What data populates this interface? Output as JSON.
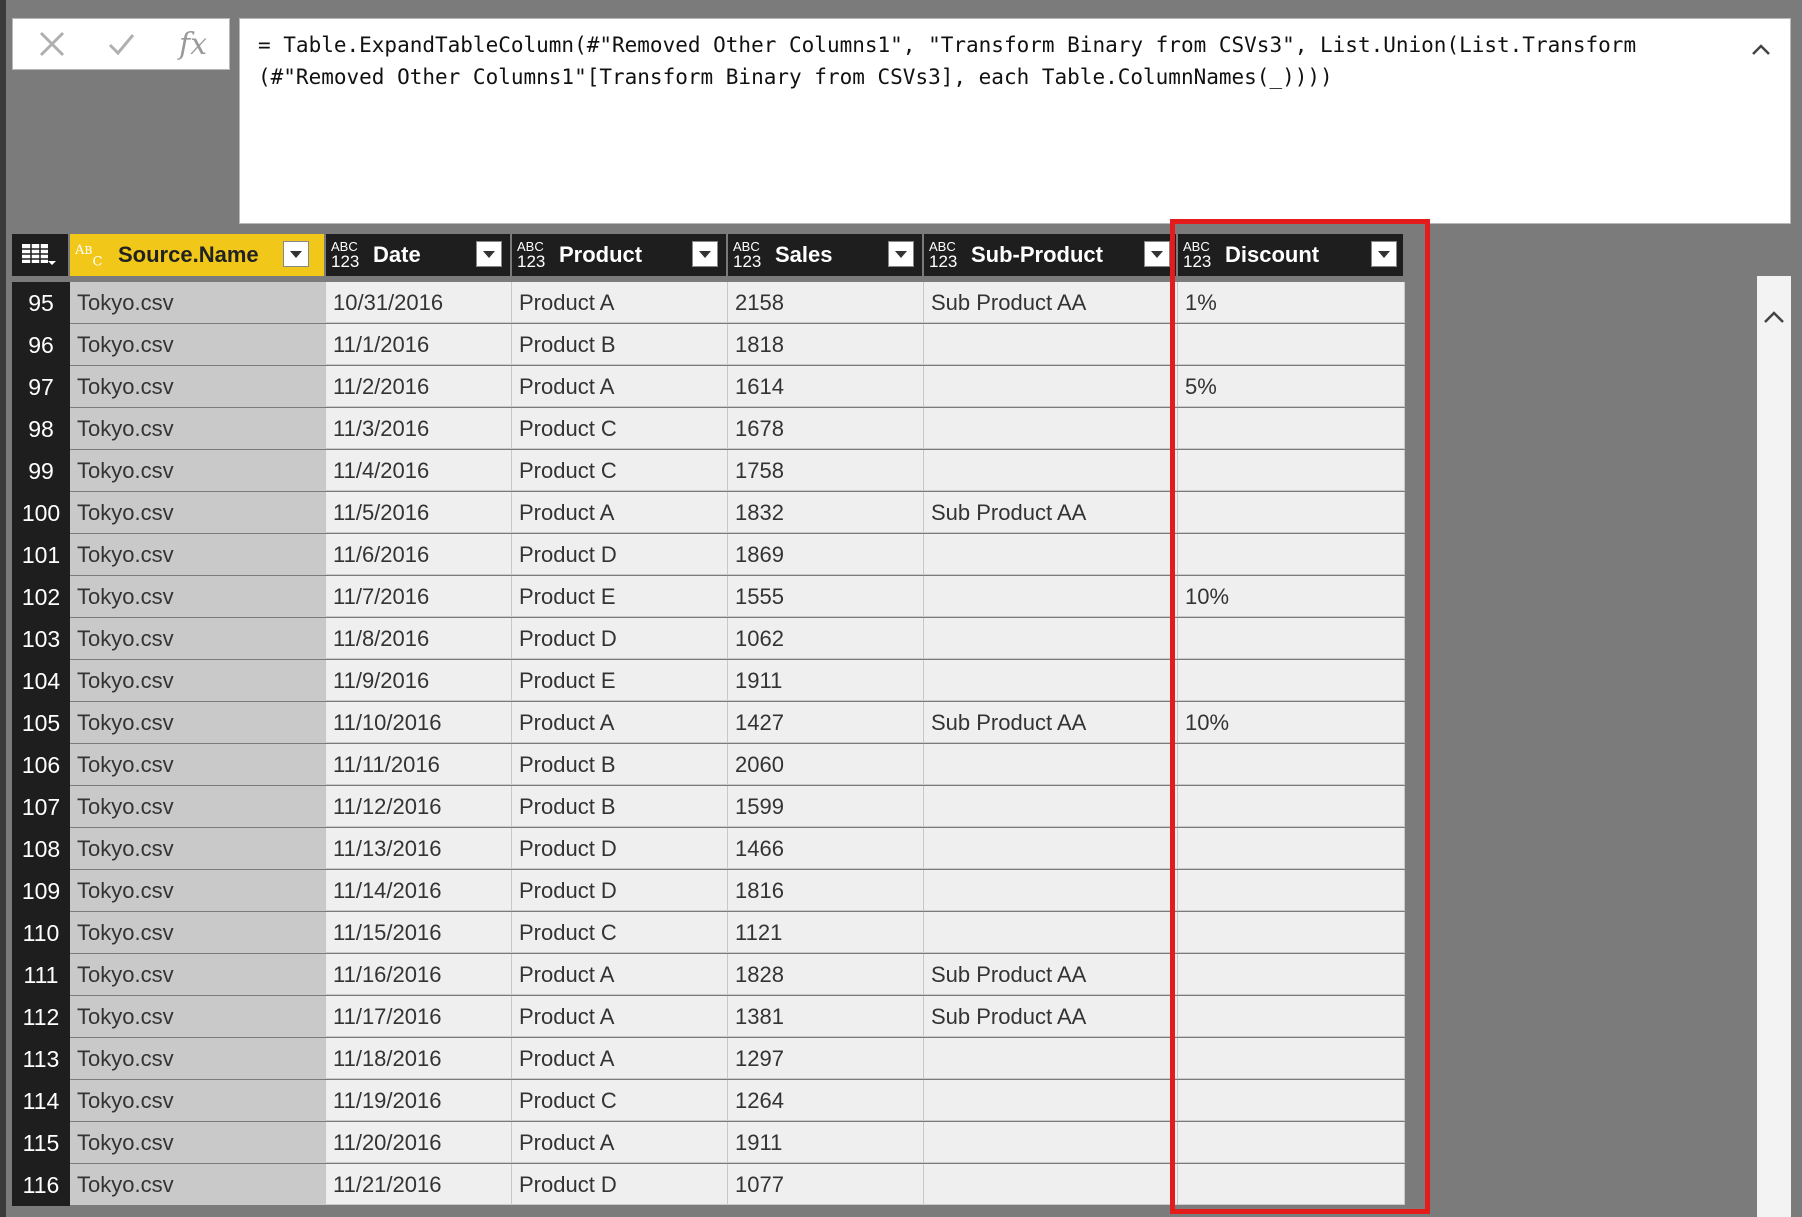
{
  "formula_bar": {
    "cancel_icon": "close-icon",
    "commit_icon": "check-icon",
    "fx_label": "fx",
    "formula": "= Table.ExpandTableColumn(#\"Removed Other Columns1\", \"Transform Binary from CSVs3\", List.Union(List.Transform\n(#\"Removed Other Columns1\"[Transform Binary from CSVs3], each Table.ColumnNames(_))))"
  },
  "columns": [
    {
      "label": "Source.Name",
      "type": "text",
      "type_abc": "ABC",
      "type_num": ""
    },
    {
      "label": "Date",
      "type": "any",
      "type_abc": "ABC",
      "type_num": "123"
    },
    {
      "label": "Product",
      "type": "any",
      "type_abc": "ABC",
      "type_num": "123"
    },
    {
      "label": "Sales",
      "type": "any",
      "type_abc": "ABC",
      "type_num": "123"
    },
    {
      "label": "Sub-Product",
      "type": "any",
      "type_abc": "ABC",
      "type_num": "123"
    },
    {
      "label": "Discount",
      "type": "any",
      "type_abc": "ABC",
      "type_num": "123"
    }
  ],
  "rows": [
    {
      "n": "95",
      "cells": [
        "Tokyo.csv",
        "10/31/2016",
        "Product A",
        "2158",
        "Sub Product AA",
        "1%"
      ]
    },
    {
      "n": "96",
      "cells": [
        "Tokyo.csv",
        "11/1/2016",
        "Product B",
        "1818",
        "",
        ""
      ]
    },
    {
      "n": "97",
      "cells": [
        "Tokyo.csv",
        "11/2/2016",
        "Product A",
        "1614",
        "",
        "5%"
      ]
    },
    {
      "n": "98",
      "cells": [
        "Tokyo.csv",
        "11/3/2016",
        "Product C",
        "1678",
        "",
        ""
      ]
    },
    {
      "n": "99",
      "cells": [
        "Tokyo.csv",
        "11/4/2016",
        "Product C",
        "1758",
        "",
        ""
      ]
    },
    {
      "n": "100",
      "cells": [
        "Tokyo.csv",
        "11/5/2016",
        "Product A",
        "1832",
        "Sub Product AA",
        ""
      ]
    },
    {
      "n": "101",
      "cells": [
        "Tokyo.csv",
        "11/6/2016",
        "Product D",
        "1869",
        "",
        ""
      ]
    },
    {
      "n": "102",
      "cells": [
        "Tokyo.csv",
        "11/7/2016",
        "Product E",
        "1555",
        "",
        "10%"
      ]
    },
    {
      "n": "103",
      "cells": [
        "Tokyo.csv",
        "11/8/2016",
        "Product D",
        "1062",
        "",
        ""
      ]
    },
    {
      "n": "104",
      "cells": [
        "Tokyo.csv",
        "11/9/2016",
        "Product E",
        "1911",
        "",
        ""
      ]
    },
    {
      "n": "105",
      "cells": [
        "Tokyo.csv",
        "11/10/2016",
        "Product A",
        "1427",
        "Sub Product AA",
        "10%"
      ]
    },
    {
      "n": "106",
      "cells": [
        "Tokyo.csv",
        "11/11/2016",
        "Product B",
        "2060",
        "",
        ""
      ]
    },
    {
      "n": "107",
      "cells": [
        "Tokyo.csv",
        "11/12/2016",
        "Product B",
        "1599",
        "",
        ""
      ]
    },
    {
      "n": "108",
      "cells": [
        "Tokyo.csv",
        "11/13/2016",
        "Product D",
        "1466",
        "",
        ""
      ]
    },
    {
      "n": "109",
      "cells": [
        "Tokyo.csv",
        "11/14/2016",
        "Product D",
        "1816",
        "",
        ""
      ]
    },
    {
      "n": "110",
      "cells": [
        "Tokyo.csv",
        "11/15/2016",
        "Product C",
        "1121",
        "",
        ""
      ]
    },
    {
      "n": "111",
      "cells": [
        "Tokyo.csv",
        "11/16/2016",
        "Product A",
        "1828",
        "Sub Product AA",
        ""
      ]
    },
    {
      "n": "112",
      "cells": [
        "Tokyo.csv",
        "11/17/2016",
        "Product A",
        "1381",
        "Sub Product AA",
        ""
      ]
    },
    {
      "n": "113",
      "cells": [
        "Tokyo.csv",
        "11/18/2016",
        "Product A",
        "1297",
        "",
        ""
      ]
    },
    {
      "n": "114",
      "cells": [
        "Tokyo.csv",
        "11/19/2016",
        "Product C",
        "1264",
        "",
        ""
      ]
    },
    {
      "n": "115",
      "cells": [
        "Tokyo.csv",
        "11/20/2016",
        "Product A",
        "1911",
        "",
        ""
      ]
    },
    {
      "n": "116",
      "cells": [
        "Tokyo.csv",
        "11/21/2016",
        "Product D",
        "1077",
        "",
        ""
      ]
    }
  ],
  "highlight": {
    "column": "Discount",
    "color": "#e31b1b"
  },
  "colors": {
    "active_header": "#f1c81a",
    "header_bg": "#1e1e1e",
    "cell_bg": "#efefef",
    "source_col_bg": "#c9c9c9"
  }
}
